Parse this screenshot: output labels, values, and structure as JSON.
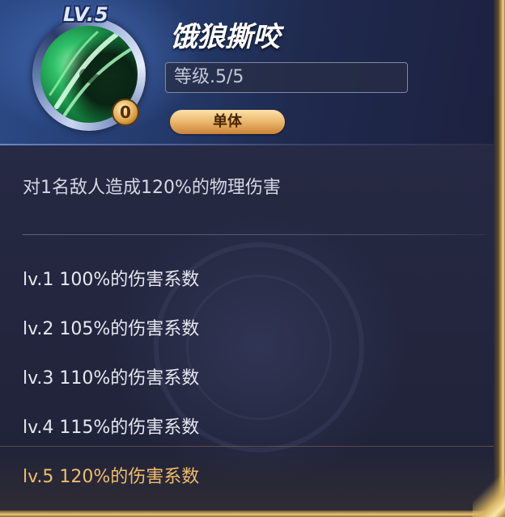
{
  "skill": {
    "level_label": "LV.5",
    "cost": "0",
    "name": "饿狼撕咬",
    "level": "等级.5/5",
    "target_tag": "单体",
    "icon": "green-claw-slash-icon"
  },
  "description": "对1名敌人造成120%的物理伤害",
  "levels": [
    {
      "text": "lv.1 100%的伤害系数"
    },
    {
      "text": "lv.2 105%的伤害系数"
    },
    {
      "text": "lv.3 110%的伤害系数"
    },
    {
      "text": "lv.4 115%的伤害系数"
    },
    {
      "text": "lv.5 120%的伤害系数"
    }
  ],
  "colors": {
    "current_level": "#f1bd6a",
    "level_text": "#e6e8f0",
    "tag_pill": "#e8b266"
  }
}
